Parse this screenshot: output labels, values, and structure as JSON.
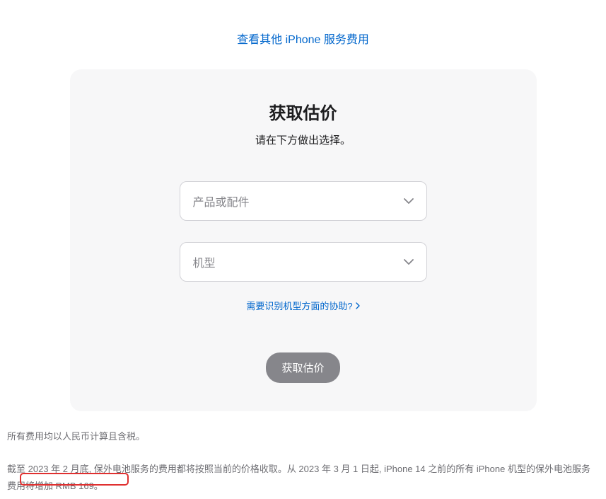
{
  "topLink": {
    "label": "查看其他 iPhone 服务费用"
  },
  "card": {
    "title": "获取估价",
    "subtitle": "请在下方做出选择。",
    "select1": {
      "placeholder": "产品或配件"
    },
    "select2": {
      "placeholder": "机型"
    },
    "helpLink": {
      "label": "需要识别机型方面的协助?"
    },
    "submit": {
      "label": "获取估价"
    }
  },
  "footer": {
    "note1": "所有费用均以人民币计算且含税。",
    "note2": "截至 2023 年 2 月底, 保外电池服务的费用都将按照当前的价格收取。从 2023 年 3 月 1 日起, iPhone 14 之前的所有 iPhone 机型的保外电池服务费用将增加 RMB 169。"
  }
}
